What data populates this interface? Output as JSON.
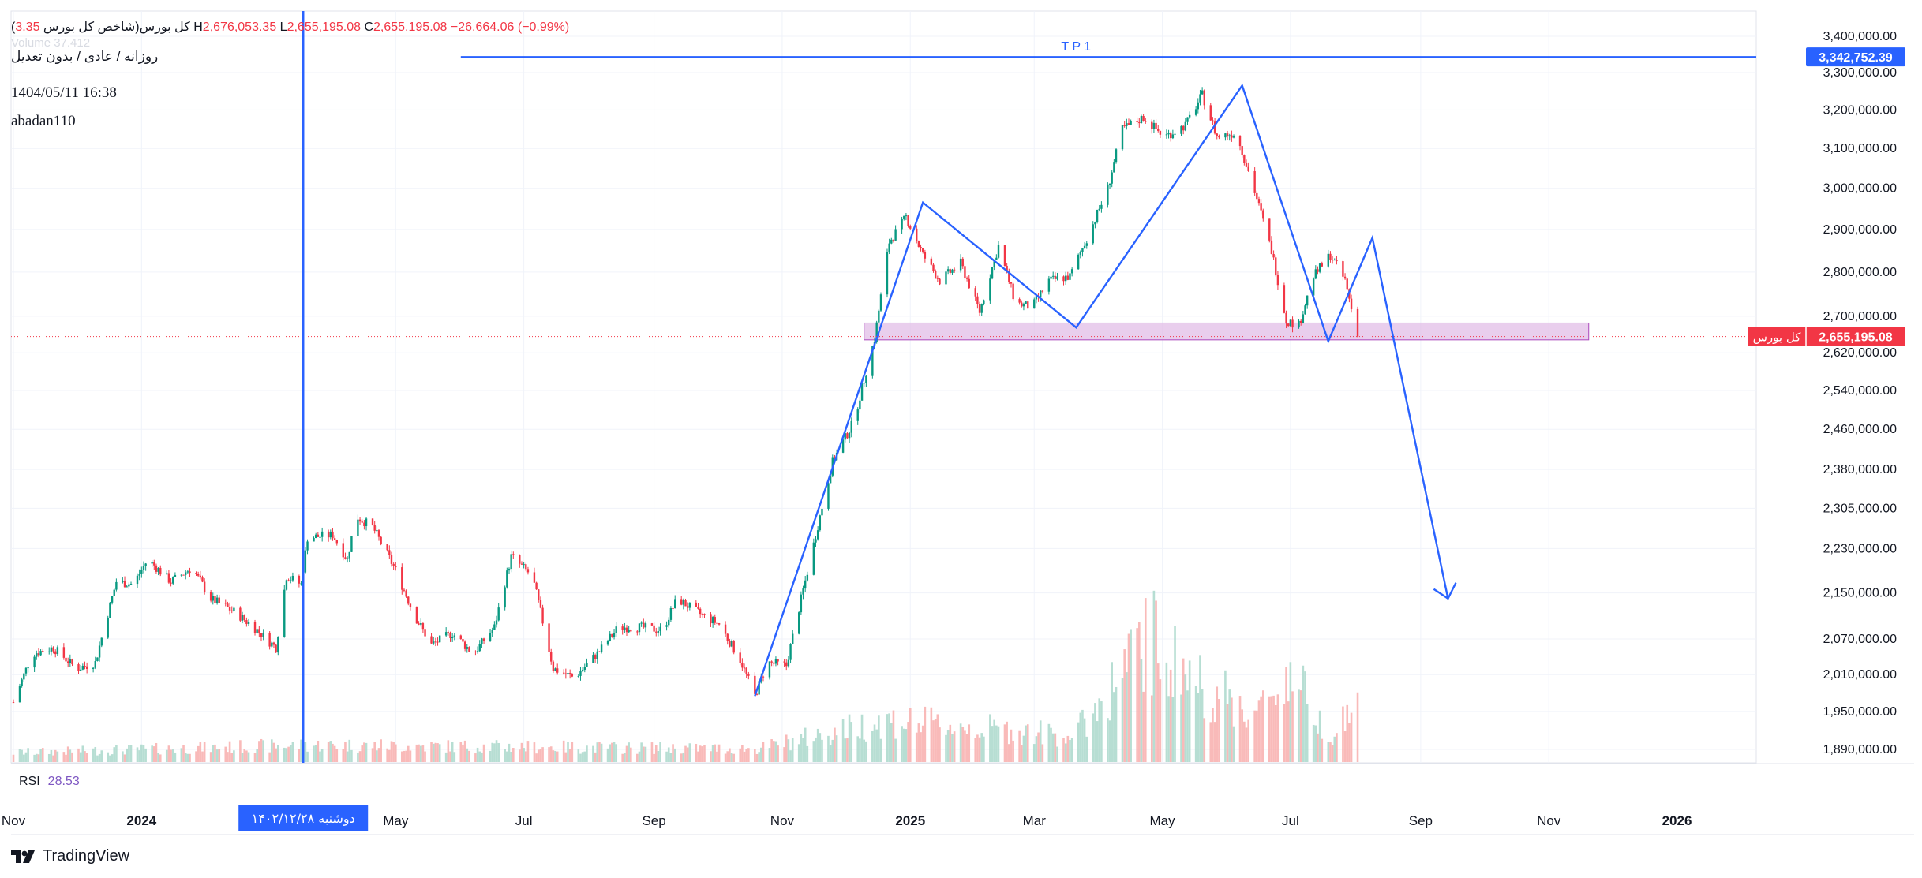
{
  "header": {
    "symbol": "(کل بورس(شاخص کل بورس",
    "open_fragment": "3.35",
    "h_label": "H",
    "high": "2,676,053.35",
    "l_label": "L",
    "low": "2,655,195.08",
    "c_label": "C",
    "close": "2,655,195.08",
    "change": "−26,664.06 (−0.99%)",
    "interval": "روزانه / عادی / بدون تعدیل",
    "datetime": "1404/05/11 16:38",
    "author": "abadan110",
    "faded_volume": "Volume 37.412"
  },
  "rsi": {
    "label": "RSI",
    "value": "28.53"
  },
  "brand": {
    "name": "TradingView"
  },
  "colors": {
    "up": "#089981",
    "down": "#f23645",
    "drawing": "#2962ff",
    "zone_fill": "#e1bee7",
    "zone_border": "#ab47bc",
    "rsi": "#7e57c2",
    "grid": "#f0f3fa"
  },
  "chart_data": {
    "type": "candlestick",
    "title": "(کل بورس(شاخص کل بورس",
    "y_axis": {
      "ticks": [
        1890000,
        1950000,
        2010000,
        2070000,
        2150000,
        2230000,
        2305000,
        2380000,
        2460000,
        2540000,
        2620000,
        2700000,
        2800000,
        2900000,
        3000000,
        3100000,
        3200000,
        3300000,
        3400000
      ],
      "tick_labels": [
        "1,890,000.00",
        "1,950,000.00",
        "2,010,000.00",
        "2,070,000.00",
        "2,150,000.00",
        "2,230,000.00",
        "2,305,000.00",
        "2,380,000.00",
        "2,460,000.00",
        "2,540,000.00",
        "2,620,000.00",
        "2,700,000.00",
        "2,800,000.00",
        "2,900,000.00",
        "3,000,000.00",
        "3,100,000.00",
        "3,200,000.00",
        "3,300,000.00",
        "3,400,000.00"
      ],
      "scale": "log"
    },
    "x_axis": {
      "start": "2023-11-01",
      "end": "2026-02-01",
      "ticks": [
        {
          "date": "2023-11-01",
          "label": "Nov",
          "bold": false
        },
        {
          "date": "2024-01-01",
          "label": "2024",
          "bold": true
        },
        {
          "date": "2024-05-01",
          "label": "May",
          "bold": false
        },
        {
          "date": "2024-07-01",
          "label": "Jul",
          "bold": false
        },
        {
          "date": "2024-09-01",
          "label": "Sep",
          "bold": false
        },
        {
          "date": "2024-11-01",
          "label": "Nov",
          "bold": false
        },
        {
          "date": "2025-01-01",
          "label": "2025",
          "bold": true
        },
        {
          "date": "2025-03-01",
          "label": "Mar",
          "bold": false
        },
        {
          "date": "2025-05-01",
          "label": "May",
          "bold": false
        },
        {
          "date": "2025-07-01",
          "label": "Jul",
          "bold": false
        },
        {
          "date": "2025-09-01",
          "label": "Sep",
          "bold": false
        },
        {
          "date": "2025-11-01",
          "label": "Nov",
          "bold": false
        },
        {
          "date": "2026-01-01",
          "label": "2026",
          "bold": true
        }
      ],
      "crosshair_date": "2024-03-18",
      "crosshair_label": "دوشنبه ۱۴۰۲/۱۲/۲۸"
    },
    "close_path": [
      [
        "2023-11-01",
        1965000
      ],
      [
        "2023-11-10",
        2045000
      ],
      [
        "2023-11-20",
        2055000
      ],
      [
        "2023-12-01",
        2020000
      ],
      [
        "2023-12-10",
        2030000
      ],
      [
        "2023-12-20",
        2170000
      ],
      [
        "2023-12-28",
        2165000
      ],
      [
        "2024-01-04",
        2210000
      ],
      [
        "2024-01-15",
        2170000
      ],
      [
        "2024-01-25",
        2195000
      ],
      [
        "2024-02-03",
        2140000
      ],
      [
        "2024-02-15",
        2115000
      ],
      [
        "2024-02-25",
        2085000
      ],
      [
        "2024-03-05",
        2055000
      ],
      [
        "2024-03-10",
        2180000
      ],
      [
        "2024-03-17",
        2165000
      ],
      [
        "2024-03-20",
        2250000
      ],
      [
        "2024-04-01",
        2255000
      ],
      [
        "2024-04-08",
        2210000
      ],
      [
        "2024-04-12",
        2290000
      ],
      [
        "2024-04-20",
        2270000
      ],
      [
        "2024-05-01",
        2190000
      ],
      [
        "2024-05-10",
        2110000
      ],
      [
        "2024-05-18",
        2060000
      ],
      [
        "2024-05-28",
        2080000
      ],
      [
        "2024-06-07",
        2045000
      ],
      [
        "2024-06-17",
        2090000
      ],
      [
        "2024-06-25",
        2215000
      ],
      [
        "2024-07-05",
        2180000
      ],
      [
        "2024-07-15",
        2020000
      ],
      [
        "2024-07-25",
        2005000
      ],
      [
        "2024-08-05",
        2045000
      ],
      [
        "2024-08-15",
        2090000
      ],
      [
        "2024-08-25",
        2090000
      ],
      [
        "2024-09-05",
        2085000
      ],
      [
        "2024-09-12",
        2140000
      ],
      [
        "2024-09-22",
        2115000
      ],
      [
        "2024-10-02",
        2095000
      ],
      [
        "2024-10-12",
        2035000
      ],
      [
        "2024-10-19",
        1975000
      ],
      [
        "2024-10-25",
        2030000
      ],
      [
        "2024-11-03",
        2025000
      ],
      [
        "2024-11-15",
        2220000
      ],
      [
        "2024-11-25",
        2395000
      ],
      [
        "2024-12-05",
        2475000
      ],
      [
        "2024-12-15",
        2650000
      ],
      [
        "2024-12-22",
        2870000
      ],
      [
        "2024-12-30",
        2930000
      ],
      [
        "2025-01-07",
        2840000
      ],
      [
        "2025-01-15",
        2780000
      ],
      [
        "2025-01-25",
        2820000
      ],
      [
        "2025-02-03",
        2710000
      ],
      [
        "2025-02-12",
        2860000
      ],
      [
        "2025-02-20",
        2730000
      ],
      [
        "2025-02-28",
        2720000
      ],
      [
        "2025-03-08",
        2780000
      ],
      [
        "2025-03-18",
        2790000
      ],
      [
        "2025-03-28",
        2900000
      ],
      [
        "2025-04-05",
        3000000
      ],
      [
        "2025-04-12",
        3150000
      ],
      [
        "2025-04-22",
        3180000
      ],
      [
        "2025-05-02",
        3130000
      ],
      [
        "2025-05-12",
        3160000
      ],
      [
        "2025-05-20",
        3240000
      ],
      [
        "2025-05-27",
        3130000
      ],
      [
        "2025-06-05",
        3140000
      ],
      [
        "2025-06-13",
        3010000
      ],
      [
        "2025-06-22",
        2850000
      ],
      [
        "2025-06-29",
        2690000
      ],
      [
        "2025-07-05",
        2680000
      ],
      [
        "2025-07-12",
        2790000
      ],
      [
        "2025-07-20",
        2840000
      ],
      [
        "2025-07-27",
        2780000
      ],
      [
        "2025-08-02",
        2655195
      ]
    ],
    "volume_shape": [
      [
        "2023-11-01",
        0.05
      ],
      [
        "2024-03-20",
        0.09
      ],
      [
        "2024-10-20",
        0.07
      ],
      [
        "2024-12-20",
        0.22
      ],
      [
        "2025-03-20",
        0.14
      ],
      [
        "2025-04-25",
        0.65
      ],
      [
        "2025-05-20",
        0.4
      ],
      [
        "2025-06-15",
        0.25
      ],
      [
        "2025-07-01",
        0.48
      ],
      [
        "2025-07-20",
        0.14
      ],
      [
        "2025-08-02",
        0.3
      ]
    ],
    "drawings": {
      "tp_line": {
        "label": "T P 1",
        "value": 3342752.39,
        "price_label": "3,342,752.39",
        "start": "2024-06-01"
      },
      "pattern_path": [
        [
          "2024-10-19",
          1975000
        ],
        [
          "2025-01-07",
          2965000
        ],
        [
          "2025-03-21",
          2675000
        ],
        [
          "2025-06-08",
          3265000
        ],
        [
          "2025-07-19",
          2645000
        ],
        [
          "2025-08-09",
          2880000
        ],
        [
          "2025-09-14",
          2140000
        ]
      ],
      "zone": {
        "start": "2024-12-10",
        "end": "2025-11-20",
        "high": 2685000,
        "low": 2648000
      },
      "last_price": {
        "value": 2655195.08,
        "name": "کل بورس",
        "price_label": "2,655,195.08"
      }
    }
  }
}
